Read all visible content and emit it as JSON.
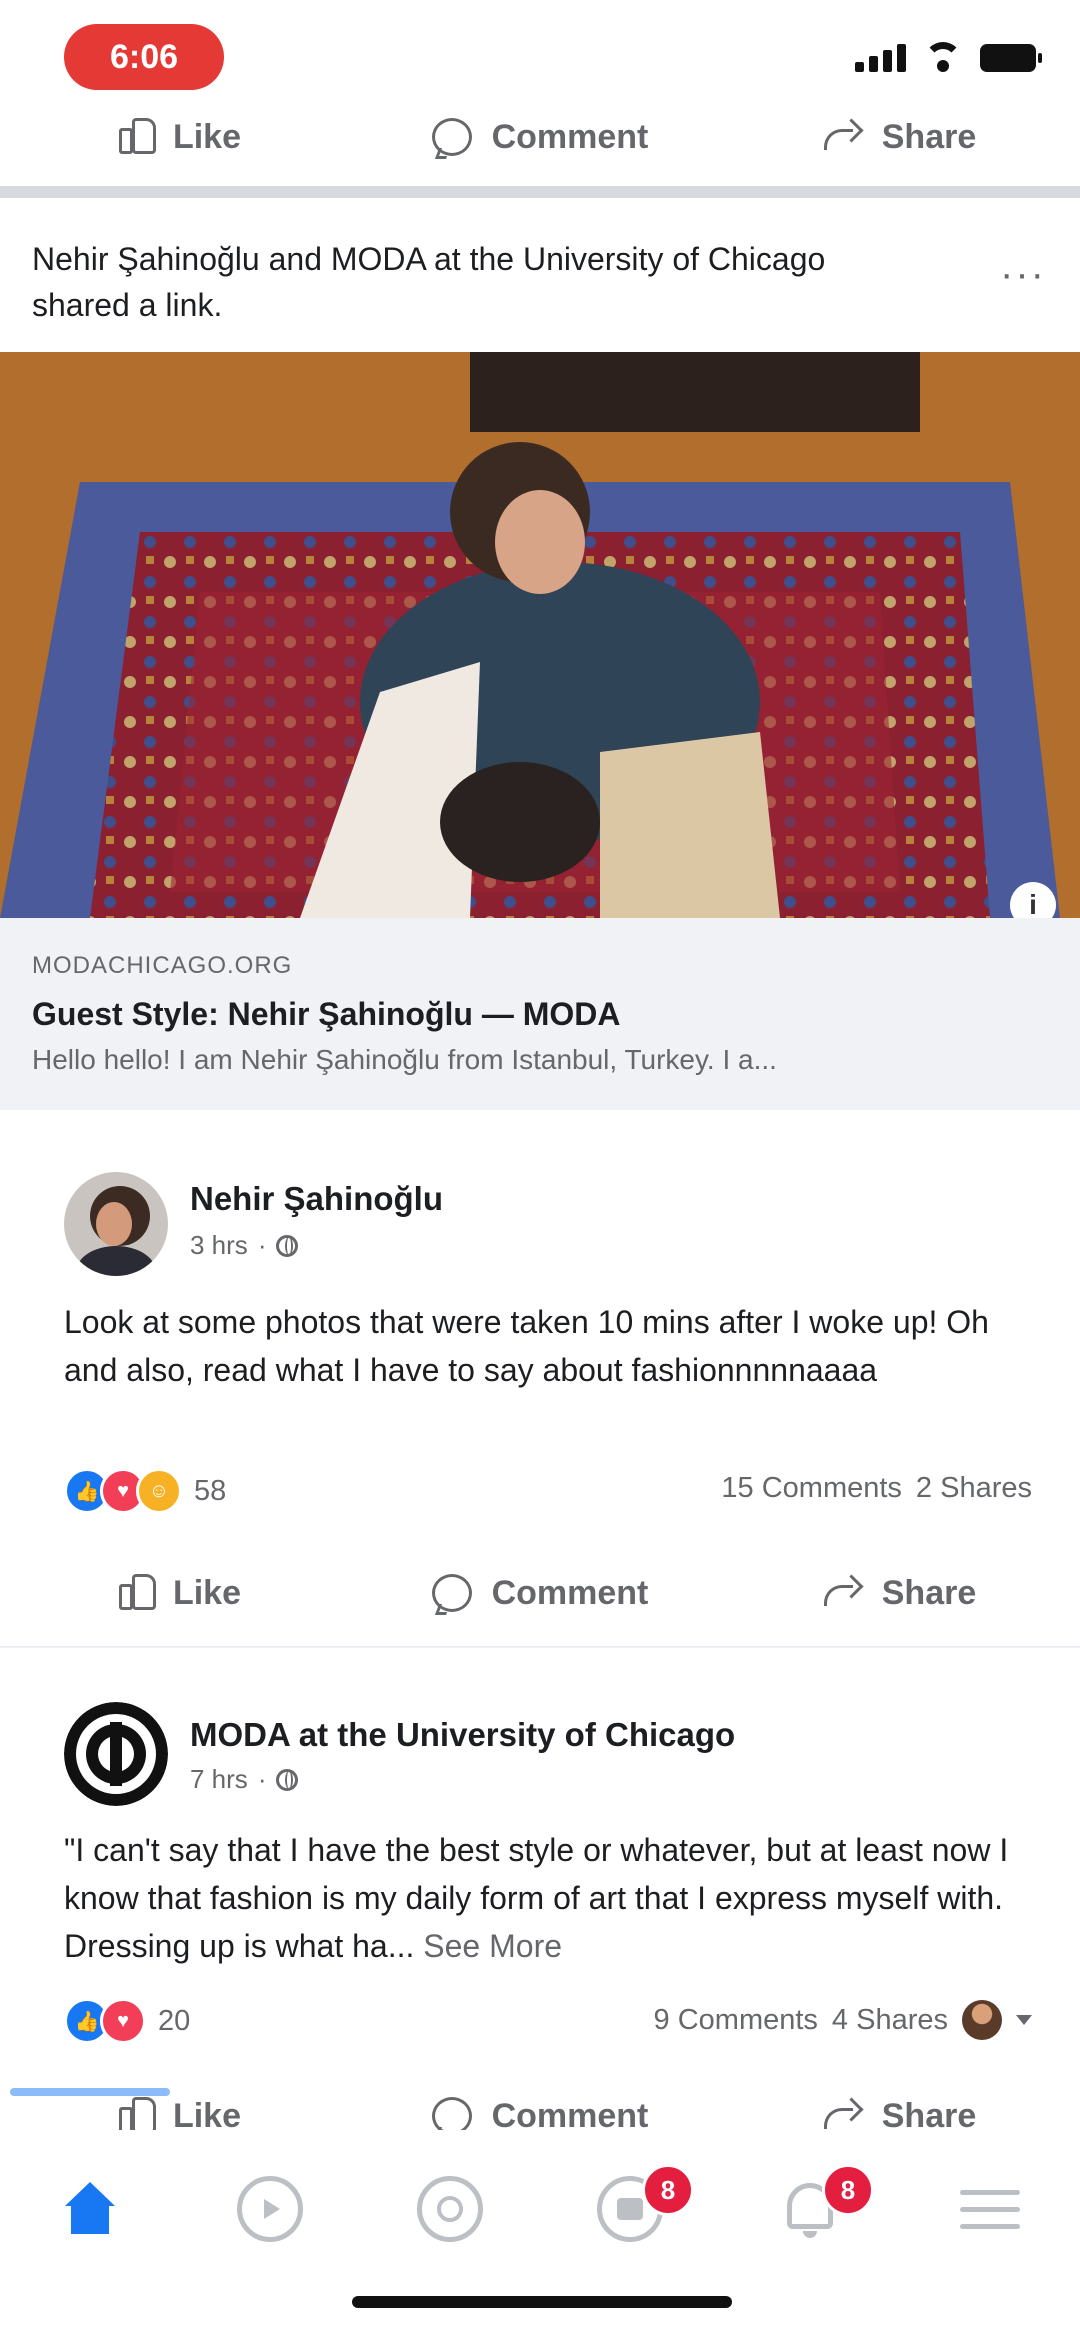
{
  "status_bar": {
    "time": "6:06"
  },
  "top_actions": {
    "like": "Like",
    "comment": "Comment",
    "share": "Share"
  },
  "shared_post": {
    "header_text": "Nehir Şahinoğlu and MODA at the University of Chicago shared a link.",
    "more_label": "···"
  },
  "link_preview": {
    "info_label": "i",
    "domain": "MODACHICAGO.ORG",
    "title": "Guest Style: Nehir Şahinoğlu — MODA",
    "description": "Hello hello! I am Nehir Şahinoğlu from Istanbul, Turkey. I a..."
  },
  "posts": [
    {
      "author": "Nehir Şahinoğlu",
      "time": "3 hrs",
      "text": "Look at some photos that were taken 10 mins after I woke up! Oh and also, read what I have to say about fashionnnnnaaaa",
      "reaction_count": "58",
      "comments": "15 Comments",
      "shares": "2 Shares",
      "actions": {
        "like": "Like",
        "comment": "Comment",
        "share": "Share"
      }
    },
    {
      "author": "MODA at the University of Chicago",
      "time": "7 hrs",
      "text": "\"I can't say that I have the best style or whatever, but at least now I know that fashion is my daily form of art that I express myself with. Dressing up is what ha...",
      "see_more": "See More",
      "reaction_count": "20",
      "comments": "9 Comments",
      "shares": "4 Shares",
      "actions": {
        "like": "Like",
        "comment": "Comment",
        "share": "Share"
      }
    }
  ],
  "bottom_nav": {
    "marketplace_badge": "8",
    "notifications_badge": "8"
  },
  "colors": {
    "brand": "#1877f2",
    "badge": "#e41e3f",
    "time_pill": "#e53935"
  },
  "icons": [
    "home-icon",
    "watch-icon",
    "groups-icon",
    "marketplace-icon",
    "notifications-icon",
    "menu-icon"
  ]
}
